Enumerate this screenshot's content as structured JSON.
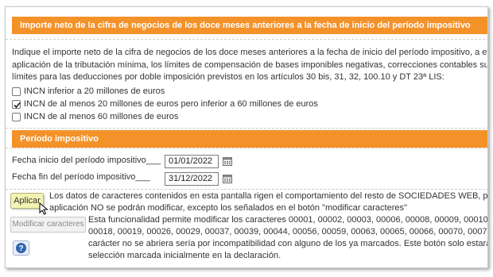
{
  "section1": {
    "title": "Importe neto de la cifra de negocios de los doce meses anteriores a la fecha de inicio del período impositivo",
    "description_lines": [
      "Indique el importe neto de la cifra de negocios de los doce meses anteriores a la fecha de inicio del período impositivo, a efectos de determin",
      "aplicación de la tributación mínima, los límites de compensación de bases imponibles negativas, correcciones contables sujetas al límite del",
      "límites para las deducciones por doble imposición previstos en los artículos 30 bis, 31, 32, 100.10 y DT 23ª LIS:"
    ],
    "options": [
      {
        "label": "INCN inferior a 20 millones de euros",
        "checked": false
      },
      {
        "label": "INCN de al menos 20 millones de euros pero inferior a 60 millones de euros",
        "checked": true
      },
      {
        "label": "INCN de al menos 60 millones de euros",
        "checked": false
      }
    ]
  },
  "section2": {
    "title": "Período impositivo",
    "start_label": "Fecha inicio del período impositivo___",
    "start_value": "01/01/2022",
    "end_label": "Fecha fin del período impositivo___",
    "end_value": "31/12/2022"
  },
  "aplicar": {
    "button_label": "Aplicar",
    "text_lines": [
      "Los datos de caracteres contenidos en esta pantalla rigen el comportamiento del resto de SOCIEDADES WEB, por lo que una vez cu",
      "aplicación NO se podrán modificar, excepto los señalados en el botón \"modificar caracteres\""
    ]
  },
  "modificar": {
    "button_label": "Modificar caracteres",
    "text_lines": [
      "Esta funcionalidad permite modificar los caracteres 00001, 00002, 00003, 00006, 00008, 00009, 00010, 00012, 00015, 00",
      "00018, 00019, 00026, 00029, 00037, 00039, 00044, 00056, 00059, 00063, 00065, 00066, 00070, 00071, 00072, 00073, 00074, 0007",
      "carácter no se abriera sería por incompatibilidad con alguno de los ya marcados. Este botón solo estará operativo desp",
      "selección marcada inicialmente en la declaración."
    ]
  },
  "colors": {
    "accent": "#f4922a",
    "aplicar_bg": "#f3f3b3"
  },
  "icons": {
    "calendar": "calendar-icon",
    "help": "help-icon",
    "cursor": "mouse-pointer-icon"
  }
}
